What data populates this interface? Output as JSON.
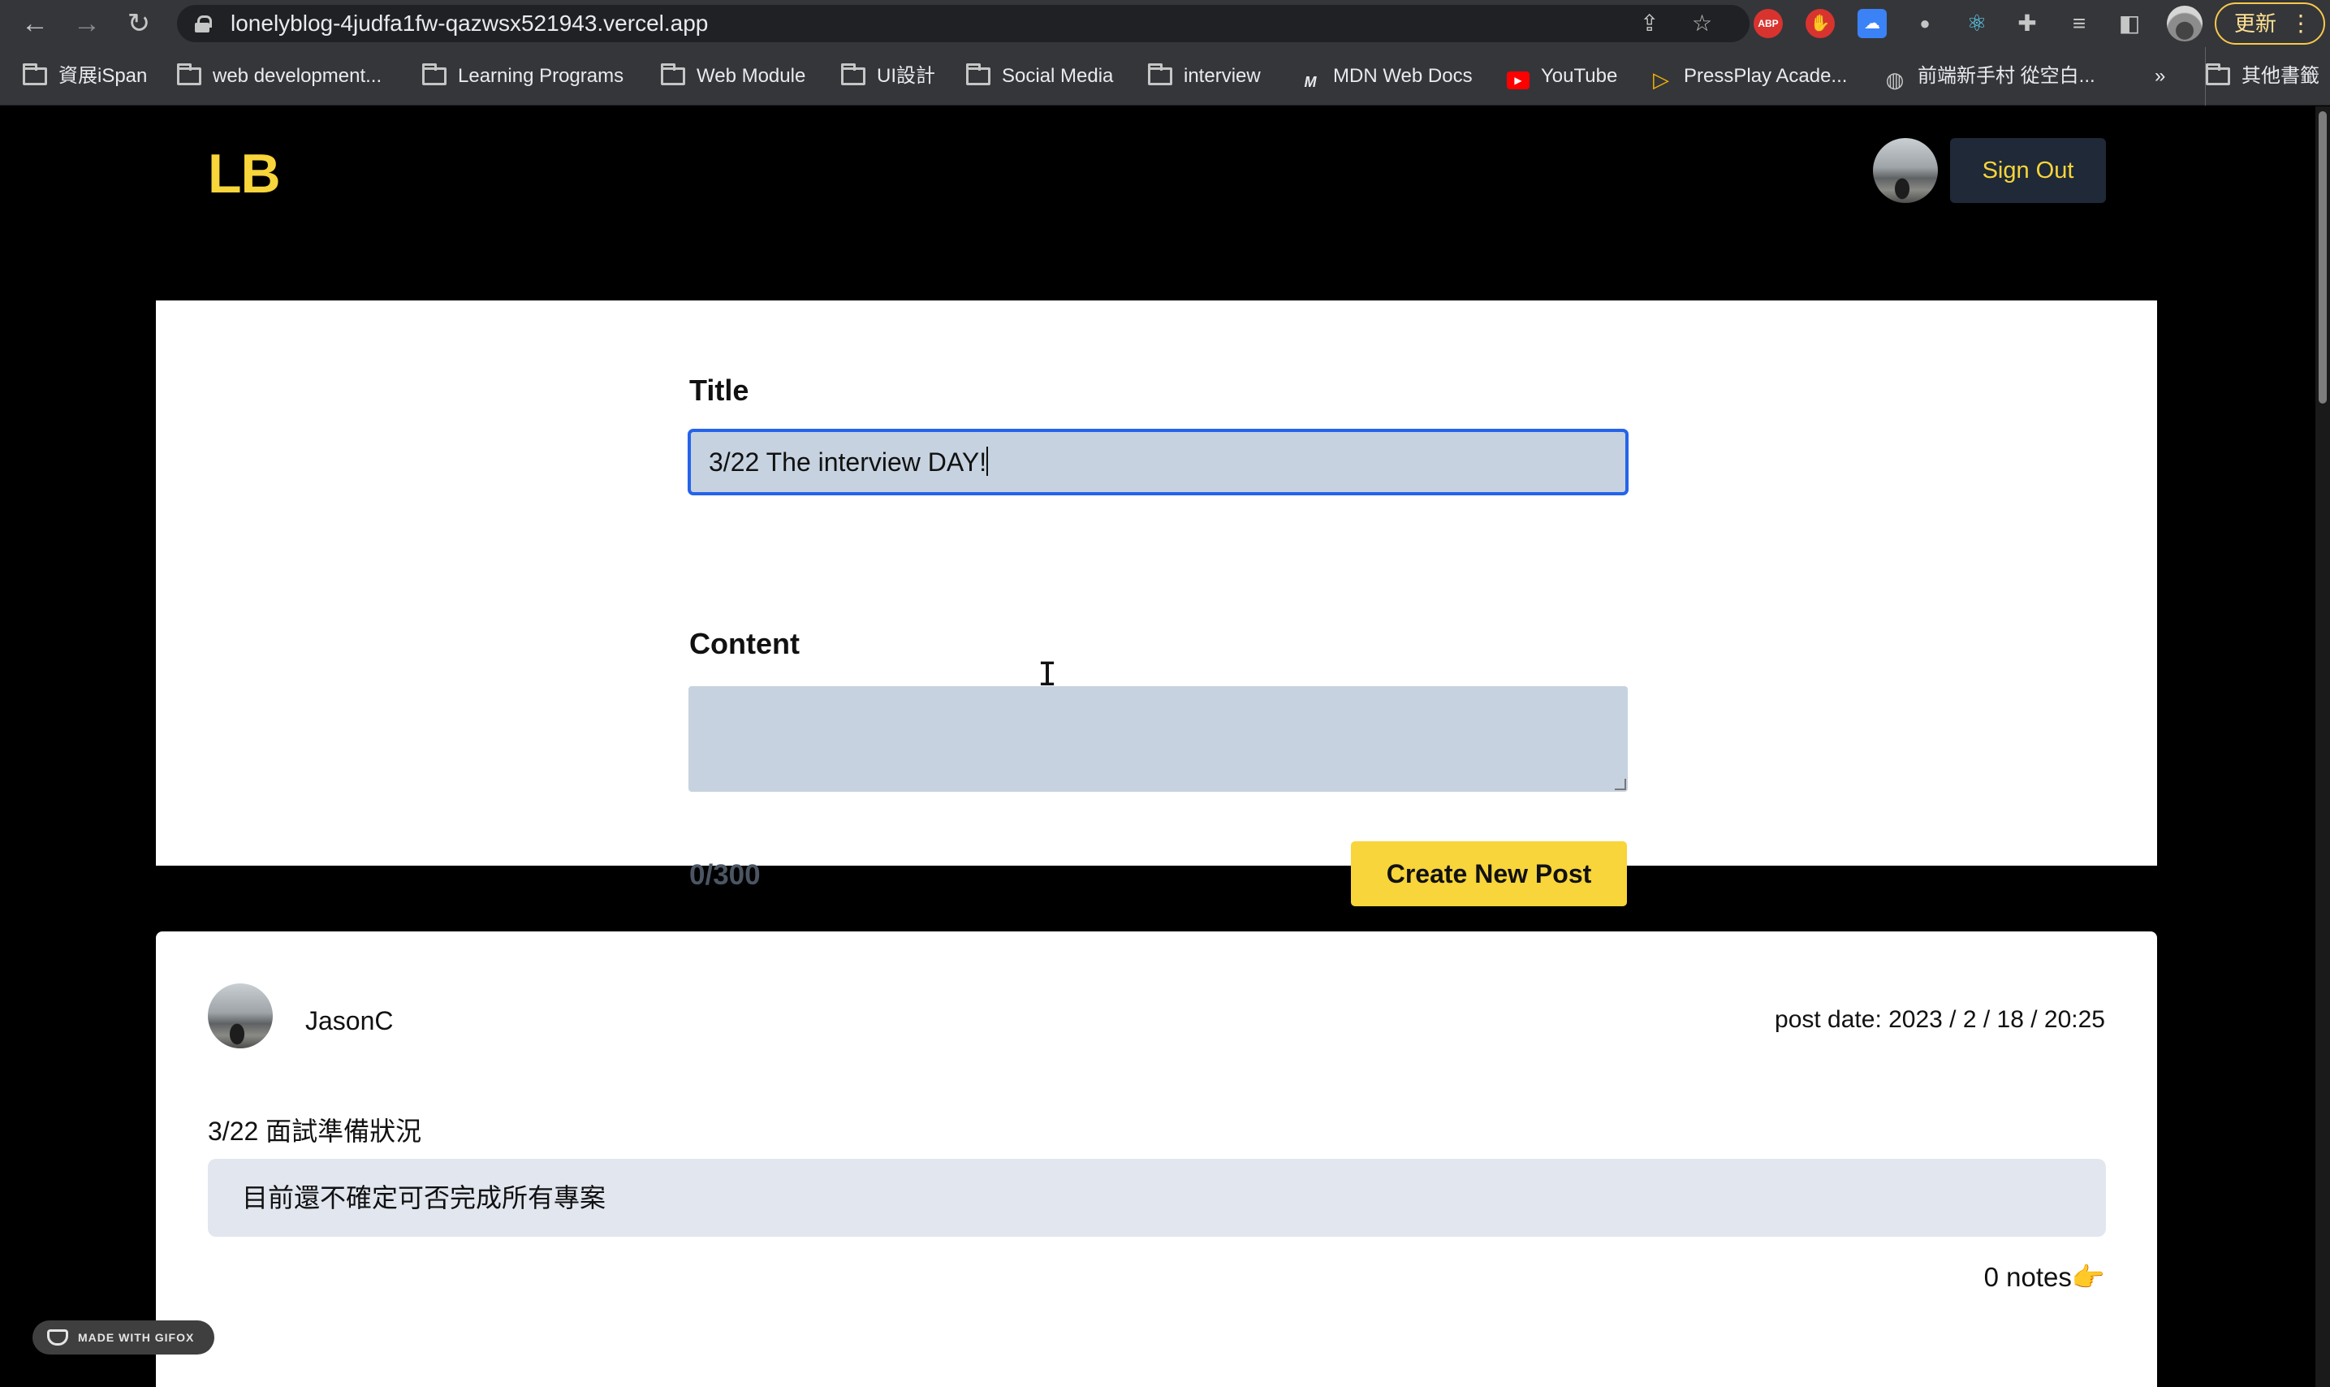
{
  "browser": {
    "url": "lonelyblog-4judfa1fw-qazwsx521943.vercel.app",
    "update_label": "更新",
    "extensions": [
      "ABP"
    ]
  },
  "bookmarks": [
    {
      "label": "資展iSpan",
      "icon": "folder-icon"
    },
    {
      "label": "web development...",
      "icon": "folder-icon"
    },
    {
      "label": "Learning Programs",
      "icon": "folder-icon"
    },
    {
      "label": "Web Module",
      "icon": "folder-icon"
    },
    {
      "label": "UI設計",
      "icon": "folder-icon"
    },
    {
      "label": "Social Media",
      "icon": "folder-icon"
    },
    {
      "label": "interview",
      "icon": "folder-icon"
    },
    {
      "label": "MDN Web Docs",
      "icon": "mdn-icon"
    },
    {
      "label": "YouTube",
      "icon": "youtube-icon"
    },
    {
      "label": "PressPlay Acade...",
      "icon": "pressplay-icon"
    },
    {
      "label": "前端新手村 從空白...",
      "icon": "globe-icon"
    },
    {
      "label": "»",
      "icon": "chevron-icon"
    },
    {
      "label": "其他書籤",
      "icon": "folder-icon"
    }
  ],
  "header": {
    "logo": "LB",
    "sign_out": "Sign Out"
  },
  "form": {
    "title_label": "Title",
    "title_value": "3/22 The interview DAY!",
    "content_label": "Content",
    "content_value": "",
    "counter": "0/300",
    "submit_label": "Create New Post"
  },
  "post": {
    "author": "JasonC",
    "date": "post date: 2023 / 2 / 18 / 20:25",
    "title": "3/22 面試準備狀況",
    "body": "目前還不確定可否完成所有專案",
    "notes": "0 notes",
    "notes_icon": "👉"
  },
  "watermark": "MADE WITH GIFOX",
  "colors": {
    "accent": "#f7d53b",
    "focus_border": "#2563eb",
    "input_bg": "#c6d2df",
    "button_dark": "#1f2937"
  }
}
